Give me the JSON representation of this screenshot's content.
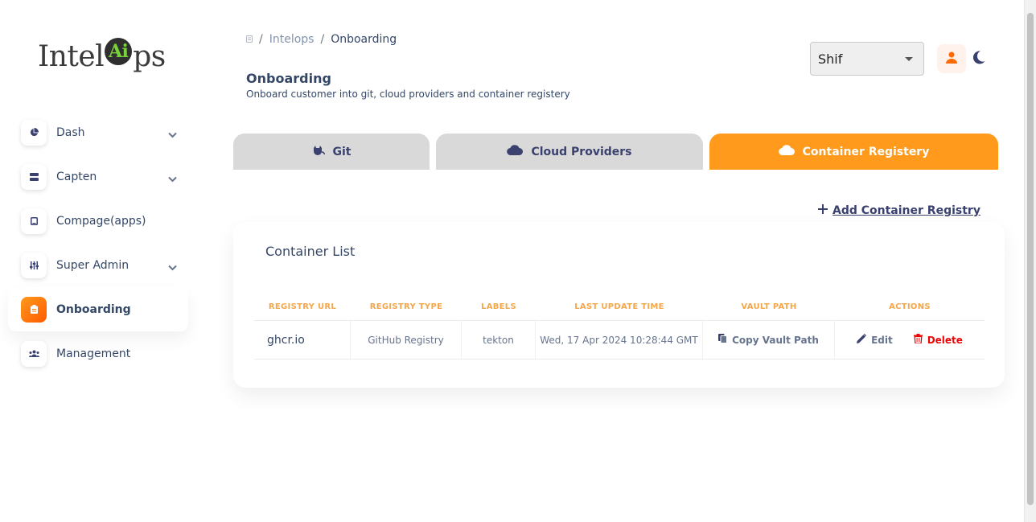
{
  "logo": {
    "text_before": "Intel",
    "badge": "Ai",
    "text_after": "ps"
  },
  "sidebar": {
    "items": [
      {
        "label": "Dash",
        "icon": "pie-chart-icon",
        "expandable": true
      },
      {
        "label": "Capten",
        "icon": "server-icon",
        "expandable": true
      },
      {
        "label": "Compage(apps)",
        "icon": "tablet-icon",
        "expandable": false
      },
      {
        "label": "Super Admin",
        "icon": "sliders-icon",
        "expandable": true
      },
      {
        "label": "Onboarding",
        "icon": "clipboard-icon",
        "expandable": false,
        "active": true
      },
      {
        "label": "Management",
        "icon": "users-icon",
        "expandable": false
      }
    ]
  },
  "breadcrumb": {
    "items": [
      "Intelops",
      "Onboarding"
    ],
    "separator": "/"
  },
  "header": {
    "title": "Onboarding",
    "subtitle": "Onboard customer into git, cloud providers and container registery",
    "select_value": "Shif"
  },
  "tabs": [
    {
      "label": "Git",
      "icon": "git-cat-icon"
    },
    {
      "label": "Cloud Providers",
      "icon": "cloud-icon"
    },
    {
      "label": "Container Registery",
      "icon": "cloud-icon",
      "active": true
    }
  ],
  "add_link": {
    "label": "Add Container Registry"
  },
  "container_list": {
    "title": "Container List",
    "columns": [
      "REGISTRY URL",
      "REGISTRY TYPE",
      "LABELS",
      "LAST UPDATE TIME",
      "VAULT PATH",
      "ACTIONS"
    ],
    "rows": [
      {
        "registry_url": "ghcr.io",
        "registry_type": "GitHub Registry",
        "labels": "tekton",
        "last_update": "Wed, 17 Apr 2024 10:28:44 GMT",
        "vault_action": "Copy Vault Path",
        "edit_label": "Edit",
        "delete_label": "Delete"
      }
    ]
  },
  "colors": {
    "accent": "#ff9a1c",
    "danger": "#ea0606",
    "text": "#344767",
    "header_text": "#f4a74a"
  }
}
